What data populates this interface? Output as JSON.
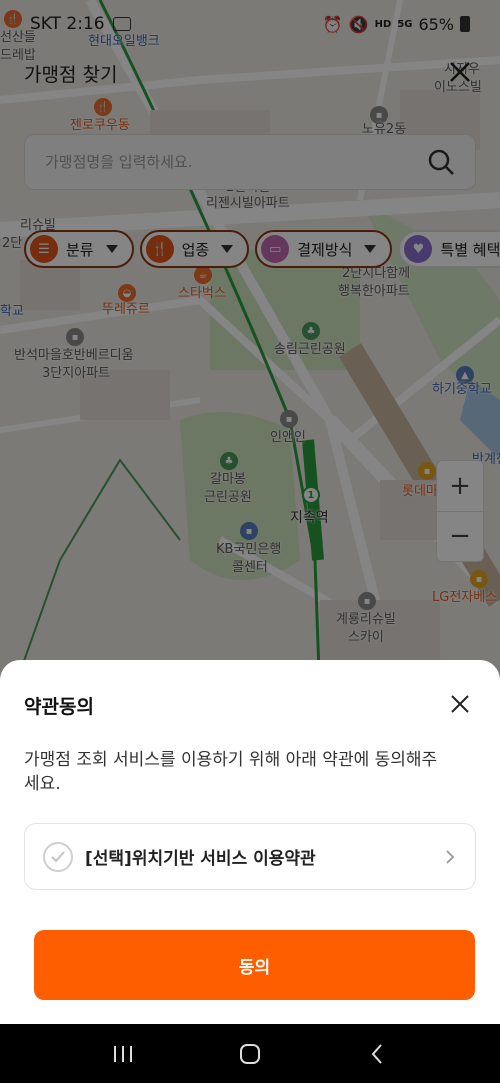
{
  "status_bar": {
    "carrier_time": "SKT 2:16",
    "battery": "65%",
    "icons": [
      "maps-notification-icon",
      "alarm-icon",
      "mute-icon",
      "hd-voice-icon",
      "5g-signal-icon",
      "battery-icon"
    ]
  },
  "header": {
    "title": "가맹점 찾기",
    "close_icon": "close-icon"
  },
  "search": {
    "placeholder": "가맹점명을 입력하세요.",
    "value": ""
  },
  "filters": [
    {
      "label": "분류",
      "icon": "list-icon",
      "color": "#e0561b"
    },
    {
      "label": "업종",
      "icon": "fork-knife-icon",
      "color": "#e0561b"
    },
    {
      "label": "결제방식",
      "icon": "card-icon",
      "color": "#c26ab3"
    },
    {
      "label": "특별 혜택",
      "icon": "heart-icon",
      "color": "#8a6fd1"
    }
  ],
  "map_labels": {
    "l1": "선산들",
    "l2": "드레밥",
    "l3": "현대오일뱅크",
    "l4": "시지우",
    "l5": "이노스빌",
    "l6": "젠로쿠우동",
    "l7": "노유2동",
    "l8": "2단지한",
    "l9": "리젠시빌아파트",
    "l10": "리슈빌",
    "l11": "2단",
    "l12": "2단지다함께",
    "l13": "행복한아파트",
    "l14": "스타벅스",
    "l15": "뚜레쥬르",
    "l16": "학교",
    "l17": "송림근린공원",
    "l18": "반석마을호반베르디움",
    "l19": "3단지아파트",
    "l20": "하기중학교",
    "l21": "인앤인",
    "l22": "반계천",
    "l23": "갈마봉",
    "l24": "근린공원",
    "l25": "롯데마",
    "l26": "지족역",
    "l27": "KB국민은행",
    "l28": "콜센터",
    "l29": "LG전자베스",
    "l30": "계룡리슈빌",
    "l31": "스카이",
    "station_number": "1"
  },
  "zoom": {
    "plus": "+",
    "minus": "−"
  },
  "sheet": {
    "title": "약관동의",
    "description": "가맹점 조회 서비스를 이용하기 위해 아래 약관에 동의해주세요.",
    "terms": [
      {
        "label": "[선택]위치기반 서비스 이용약관",
        "checked": false
      }
    ],
    "agree_button": "동의"
  },
  "colors": {
    "accent": "#ff5e00",
    "chip_border": "#8a3a13",
    "subway_line": "#2a9d3e"
  },
  "nav_bar": {
    "icons": [
      "recent-apps-icon",
      "home-icon",
      "back-icon"
    ]
  }
}
